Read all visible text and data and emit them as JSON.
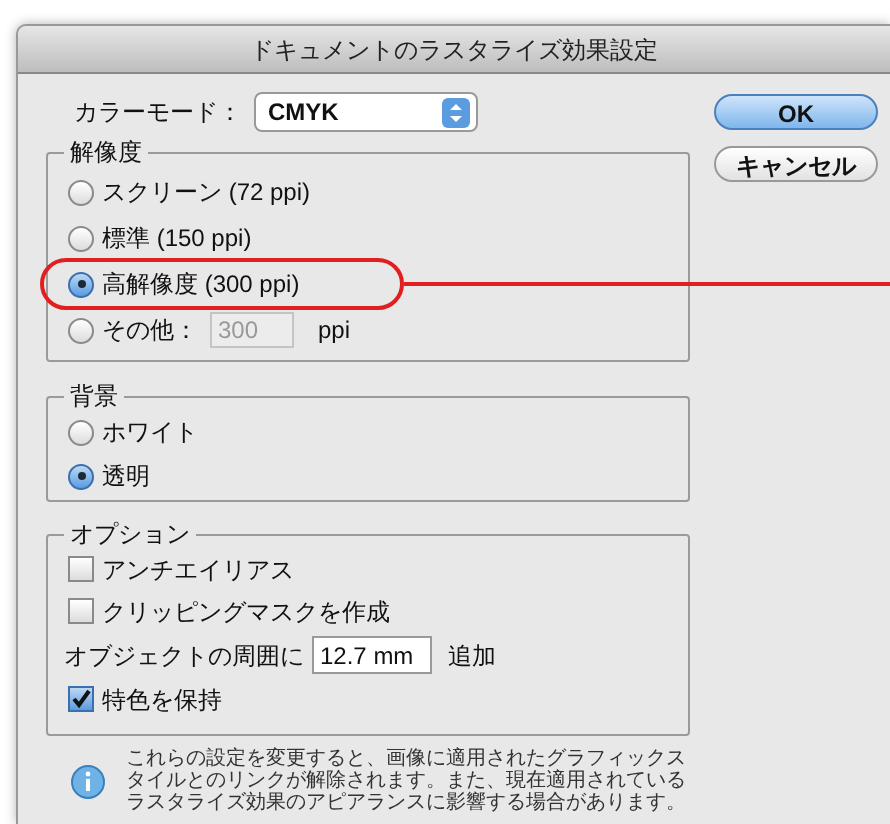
{
  "window": {
    "title": "ドキュメントのラスタライズ効果設定"
  },
  "color_mode": {
    "label": "カラーモード：",
    "value": "CMYK"
  },
  "buttons": [
    {
      "label": "OK",
      "default": true
    },
    {
      "label": "キャンセル",
      "default": false
    }
  ],
  "resolution": {
    "title": "解像度",
    "options": [
      {
        "label": "スクリーン (72 ppi)",
        "selected": false,
        "highlighted": false
      },
      {
        "label": "標準 (150 ppi)",
        "selected": false,
        "highlighted": false
      },
      {
        "label": "高解像度 (300 ppi)",
        "selected": true,
        "highlighted": true
      },
      {
        "label": "その他：",
        "selected": false,
        "highlighted": false,
        "value": "300",
        "disabled": true,
        "unit": "ppi"
      }
    ]
  },
  "background": {
    "title": "背景",
    "options": [
      {
        "label": "ホワイト",
        "selected": false
      },
      {
        "label": "透明",
        "selected": true
      }
    ]
  },
  "options": {
    "title": "オプション",
    "items": [
      {
        "kind": "checkbox",
        "label": "アンチエイリアス",
        "checked": false
      },
      {
        "kind": "checkbox",
        "label": "クリッピングマスクを作成",
        "checked": false
      },
      {
        "kind": "field",
        "label": "オブジェクトの周囲に",
        "value": "12.7 mm",
        "suffix": "追加"
      },
      {
        "kind": "checkbox",
        "label": "特色を保持",
        "checked": true
      }
    ]
  },
  "note": "これらの設定を変更すると、画像に適用されたグラフィックスタイルとのリンクが解除されます。また、現在適用されているラスタライズ効果のアピアランスに影響する場合があります。"
}
